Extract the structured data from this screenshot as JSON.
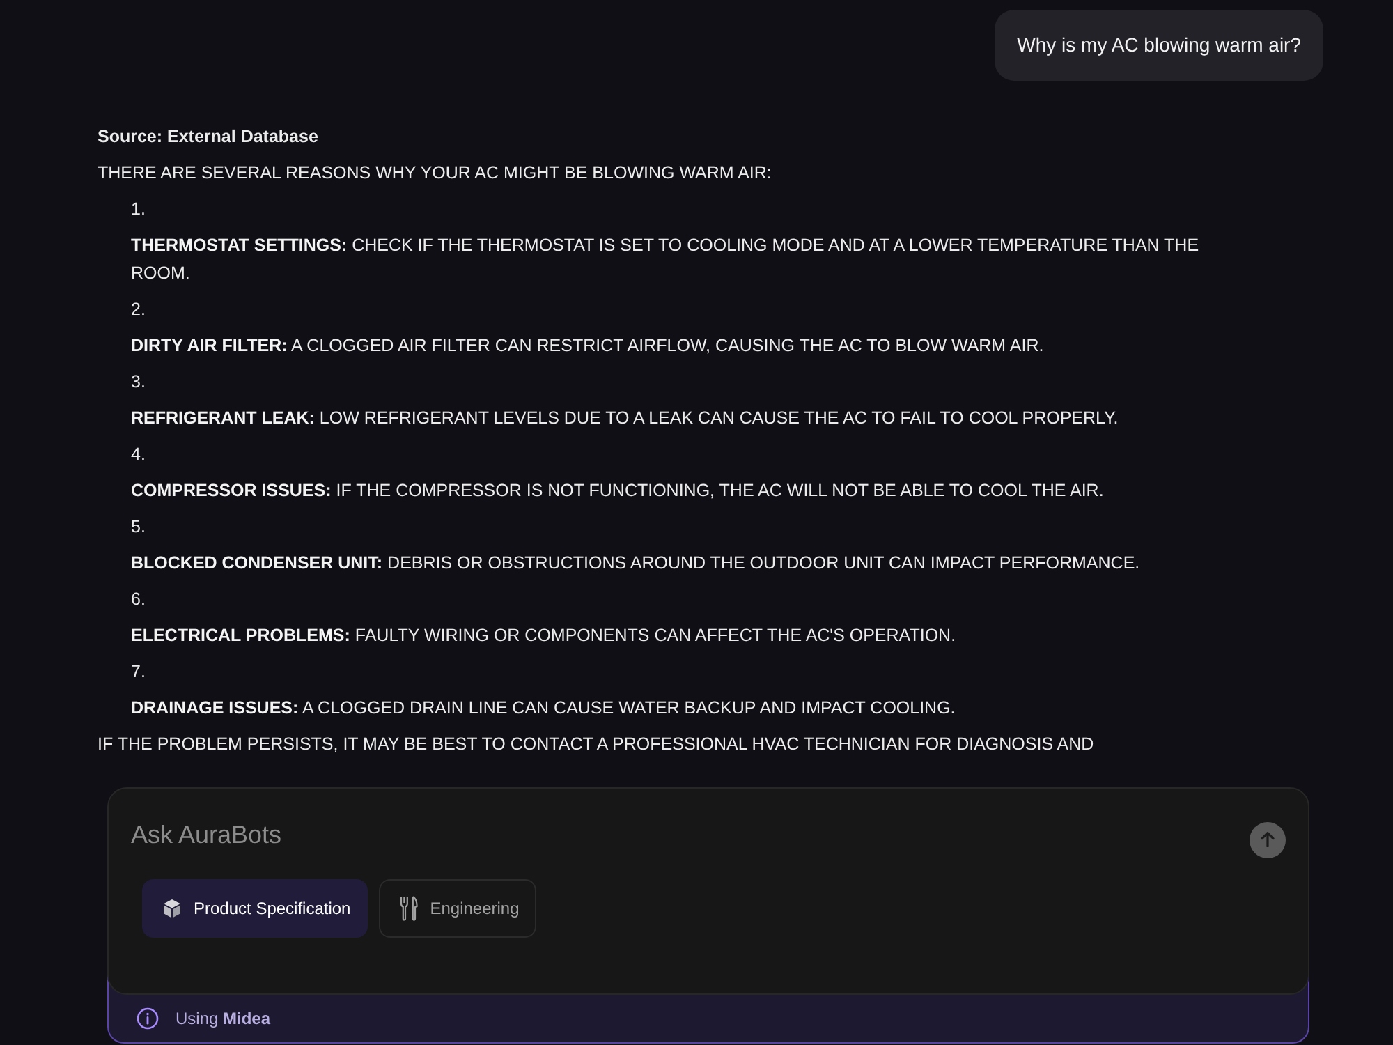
{
  "user_message": {
    "text": "Why is my AC blowing warm air?"
  },
  "assistant_message": {
    "source": "Source: External Database",
    "intro": "THERE ARE SEVERAL REASONS WHY YOUR AC MIGHT BE BLOWING WARM AIR:",
    "items": [
      {
        "number": "1.",
        "text": "**THERMOSTAT SETTINGS:** CHECK IF THE THERMOSTAT IS SET TO COOLING MODE AND AT A LOWER TEMPERATURE THAN THE ROOM."
      },
      {
        "number": "2.",
        "text": "**DIRTY AIR FILTER:** A CLOGGED AIR FILTER CAN RESTRICT AIRFLOW, CAUSING THE AC TO BLOW WARM AIR."
      },
      {
        "number": "3.",
        "text": "**REFRIGERANT LEAK:** LOW REFRIGERANT LEVELS DUE TO A LEAK CAN CAUSE THE AC TO FAIL TO COOL PROPERLY."
      },
      {
        "number": "4.",
        "text": "**COMPRESSOR ISSUES:** IF THE COMPRESSOR IS NOT FUNCTIONING, THE AC WILL NOT BE ABLE TO COOL THE AIR."
      },
      {
        "number": "5.",
        "text": "**BLOCKED CONDENSER UNIT:** DEBRIS OR OBSTRUCTIONS AROUND THE OUTDOOR UNIT CAN IMPACT PERFORMANCE."
      },
      {
        "number": "6.",
        "text": "**ELECTRICAL PROBLEMS:** FAULTY WIRING OR COMPONENTS CAN AFFECT THE AC'S OPERATION."
      },
      {
        "number": "7.",
        "text": "**DRAINAGE ISSUES:** A CLOGGED DRAIN LINE CAN CAUSE WATER BACKUP AND IMPACT COOLING."
      }
    ],
    "closing": "IF THE PROBLEM PERSISTS, IT MAY BE BEST TO CONTACT A PROFESSIONAL HVAC TECHNICIAN FOR DIAGNOSIS AND"
  },
  "composer": {
    "placeholder": "Ask AuraBots",
    "modes": [
      {
        "kind": "cube",
        "label": "Product Specification",
        "selected": true
      },
      {
        "kind": "utensils",
        "label": "Engineering",
        "selected": false
      }
    ]
  },
  "context_bar": {
    "text": "Using **Midea**"
  }
}
